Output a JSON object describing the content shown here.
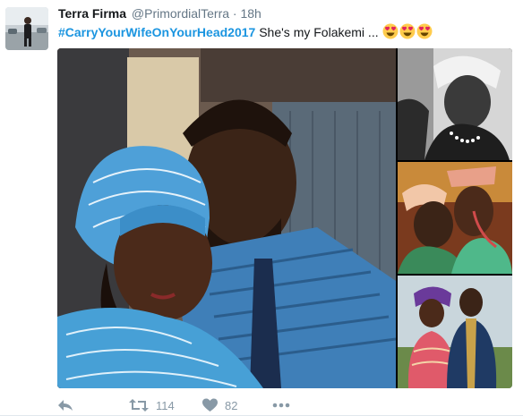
{
  "tweet": {
    "display_name": "Terra Firma",
    "handle": "@PrimordialTerra",
    "separator": "·",
    "timestamp": "18h",
    "hashtag": "#CarryYourWifeOnYourHead2017",
    "text": " She's my Folakemi ... ",
    "emoji": [
      "heart-eyes",
      "heart-eyes",
      "heart-eyes"
    ]
  },
  "media": {
    "main_photo": "couple-in-blue-attire",
    "side_photos": [
      "bride-in-white-gele",
      "couple-kissing",
      "couple-standing-outdoors"
    ]
  },
  "actions": {
    "retweet_count": "114",
    "like_count": "82"
  },
  "colors": {
    "link": "#1b95e0",
    "muted": "#657786",
    "icon": "#8899a6"
  }
}
